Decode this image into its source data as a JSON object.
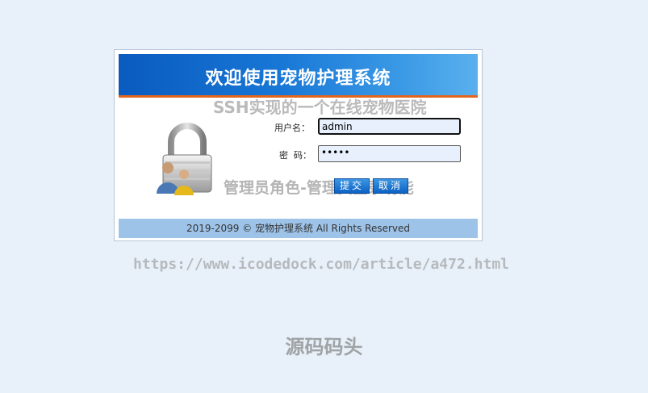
{
  "login": {
    "title": "欢迎使用宠物护理系统",
    "username_label": "用户名：",
    "username_value": "admin",
    "password_label": "密  码：",
    "password_value": "•••••",
    "submit_label": "提交",
    "cancel_label": "取消",
    "footer": "2019-2099 © 宠物护理系统 All Rights Reserved"
  },
  "watermarks": {
    "subtitle": "SSH实现的一个在线宠物医院",
    "role": "管理员角色-管理员登录功能",
    "url": "https://www.icodedock.com/article/a472.html",
    "brand": "源码码头"
  },
  "colors": {
    "banner_blue": "#0a5bbf",
    "banner_accent_line": "#e3651e",
    "footer_bar": "#9ec3e8",
    "page_background": "#e8f0f9"
  },
  "icons": {
    "illustration": "padlock-users-icon"
  }
}
